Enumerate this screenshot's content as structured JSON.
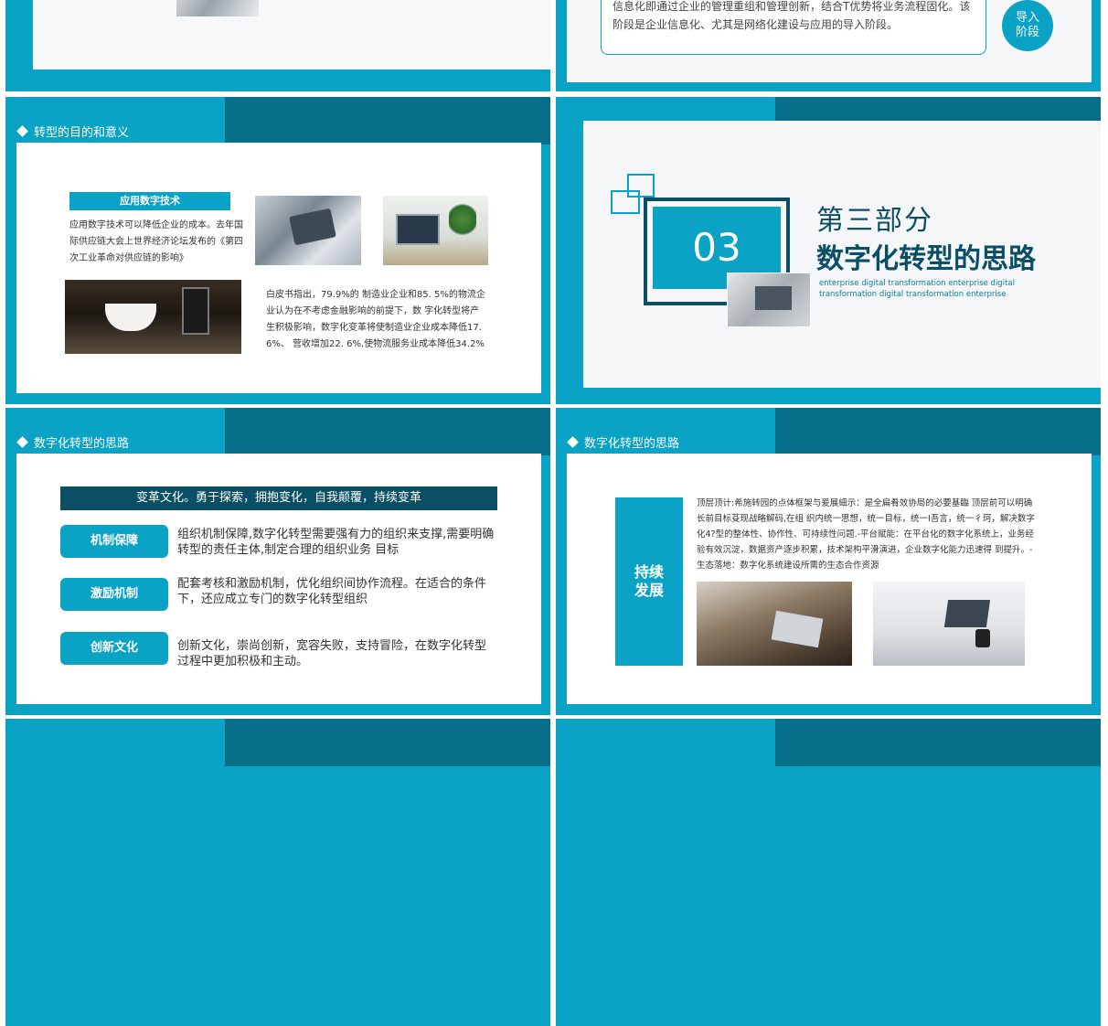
{
  "slide1": {
    "text": "信息化即通过企业的管理重组和管理创新，结合T优势将业务流程固化。该阶段是企业信息化、尤其是网络化建设与应用的导入阶段。",
    "badge": "导入\n阶段"
  },
  "slide2": {
    "section": "转型的目的和意义",
    "tag": "应用数字技术",
    "para1": "应用数字技术可以降低企业的成本。去年国际供应链大会上世界经济论坛发布的《第四次工业革命对供应链的影响》",
    "para2": "白皮书指出，79.9%的 制造业企业和85. 5%的物流企业认为在不考虑金融影响的前提下，数 字化转型将产生积极影响，数字化变革将使制造业企业成本降低17. 6%、 营收增加22. 6%,使物流服务业成本降低34.2%"
  },
  "slide3": {
    "number": "03",
    "part": "第三部分",
    "title": "数字化转型的思路",
    "en": "enterprise digital transformation enterprise digital transformation digital transformation enterprise"
  },
  "slide4": {
    "section": "数字化转型的思路",
    "banner": "变革文化。勇于探索，拥抱变化，自我颠覆，持续变革",
    "items": [
      {
        "label": "机制保障",
        "text": "组织机制保障,数字化转型需要强有力的组织来支撑,需要明确转型的责任主体,制定合理的组织业务 目标"
      },
      {
        "label": "激励机制",
        "text": "配套考核和激励机制，优化组织间协作流程。在适合的条件下，还应成立专门的数字化转型组织"
      },
      {
        "label": "创新文化",
        "text": "创新文化，崇尚创新，宽容失败，支持冒险，在数字化转型过程中更加积极和主动。"
      }
    ]
  },
  "slide5": {
    "section": "数字化转型的思路",
    "tag": "持续\n发展",
    "text": "顶层顶计:希施转园的点体框架与爰展細示：是全扁肴效协局的必要基臨 顶层前可以明确长前目标芟现战略解码,在组 织内统一思想，统一目标，统一I吾言，统一彳珂，解决数字化4?型的整体性、协作性、可持续性问题.-平台赋能：在平台化的数字化系统上，业务经验有效沉淀，数据资产逐步积累，技术架构平滑演进，企业数字化能力迅速得 到提升。-生态落地：数字化系统建设所需的生态合作资源"
  },
  "colors": {
    "teal": "#0aa3c6",
    "dark_teal": "#066e88",
    "navy_banner": "#0b4f66"
  }
}
